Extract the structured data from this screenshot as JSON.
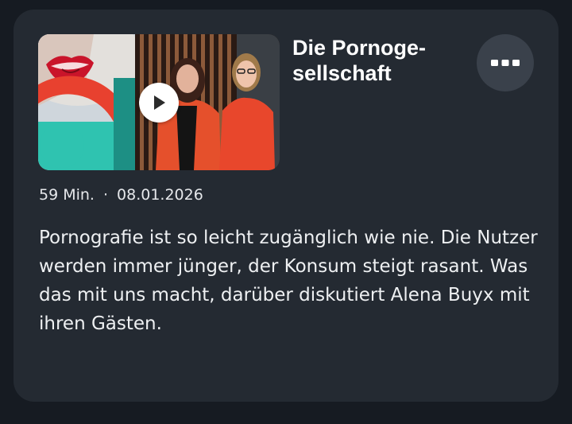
{
  "episode": {
    "title_line1": "Die Pornoge-",
    "title_line2": "sellschaft",
    "duration": "59 Min.",
    "separator": "·",
    "date": "08.01.2026",
    "description": "Pornografie ist so leicht zugänglich wie nie. Die Nutzer werden immer jünger, der Konsum steigt rasant. Was das mit uns macht, darüber diskutiert Alena Buyx mit ihren Gästen."
  },
  "icons": {
    "play": "play-icon",
    "more": "more-dots-icon"
  },
  "colors": {
    "card_background": "#242a32",
    "page_background": "#161b22",
    "more_button_background": "#3a414b",
    "accent_red": "#e8412f",
    "accent_teal": "#2fc3b0"
  }
}
